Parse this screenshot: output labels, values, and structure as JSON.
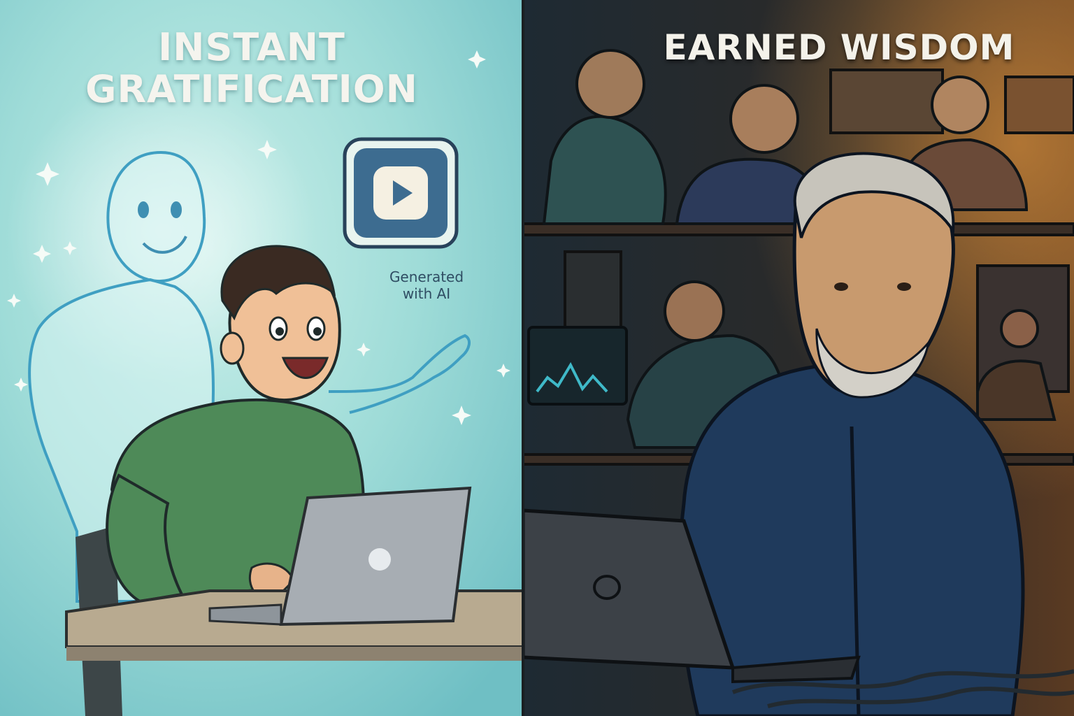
{
  "left_panel": {
    "title_line1": "INSTANT",
    "title_line2": "GRATIFICATION",
    "badge_line1": "Generated",
    "badge_line2": "with AI",
    "badge_icon": "play-icon",
    "background_color": "#8ed3d1"
  },
  "right_panel": {
    "title": "EARNED WISDOM",
    "background_color": "#2a2c2e"
  }
}
